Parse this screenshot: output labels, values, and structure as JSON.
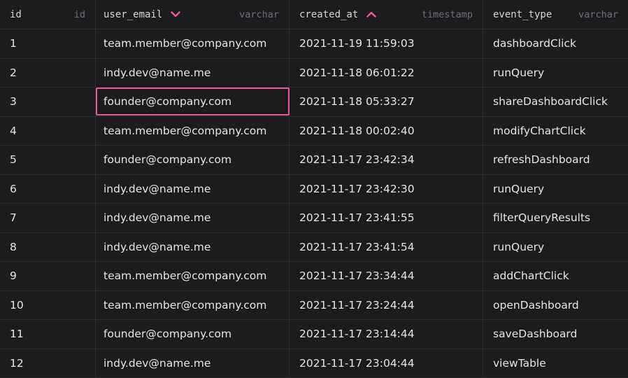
{
  "columns": [
    {
      "name": "id",
      "type": "id"
    },
    {
      "name": "user_email",
      "type": "varchar",
      "sort_icon": "chevron-down-icon"
    },
    {
      "name": "created_at",
      "type": "timestamp",
      "sort_icon": "chevron-up-icon"
    },
    {
      "name": "event_type",
      "type": "varchar"
    }
  ],
  "accent_color": "#e8589b",
  "rows": [
    {
      "id": "1",
      "user_email": "team.member@company.com",
      "created_at": "2021-11-19 11:59:03",
      "event_type": "dashboardClick"
    },
    {
      "id": "2",
      "user_email": "indy.dev@name.me",
      "created_at": "2021-11-18 06:01:22",
      "event_type": "runQuery"
    },
    {
      "id": "3",
      "user_email": "founder@company.com",
      "created_at": "2021-11-18 05:33:27",
      "event_type": "shareDashboardClick"
    },
    {
      "id": "4",
      "user_email": "team.member@company.com",
      "created_at": "2021-11-18 00:02:40",
      "event_type": "modifyChartClick"
    },
    {
      "id": "5",
      "user_email": "founder@company.com",
      "created_at": "2021-11-17 23:42:34",
      "event_type": "refreshDashboard"
    },
    {
      "id": "6",
      "user_email": "indy.dev@name.me",
      "created_at": "2021-11-17 23:42:30",
      "event_type": "runQuery"
    },
    {
      "id": "7",
      "user_email": "indy.dev@name.me",
      "created_at": "2021-11-17 23:41:55",
      "event_type": "filterQueryResults"
    },
    {
      "id": "8",
      "user_email": "indy.dev@name.me",
      "created_at": "2021-11-17 23:41:54",
      "event_type": "runQuery"
    },
    {
      "id": "9",
      "user_email": "team.member@company.com",
      "created_at": "2021-11-17 23:34:44",
      "event_type": "addChartClick"
    },
    {
      "id": "10",
      "user_email": "team.member@company.com",
      "created_at": "2021-11-17 23:24:44",
      "event_type": "openDashboard"
    },
    {
      "id": "11",
      "user_email": "founder@company.com",
      "created_at": "2021-11-17 23:14:44",
      "event_type": "saveDashboard"
    },
    {
      "id": "12",
      "user_email": "indy.dev@name.me",
      "created_at": "2021-11-17 23:04:44",
      "event_type": "viewTable"
    }
  ]
}
